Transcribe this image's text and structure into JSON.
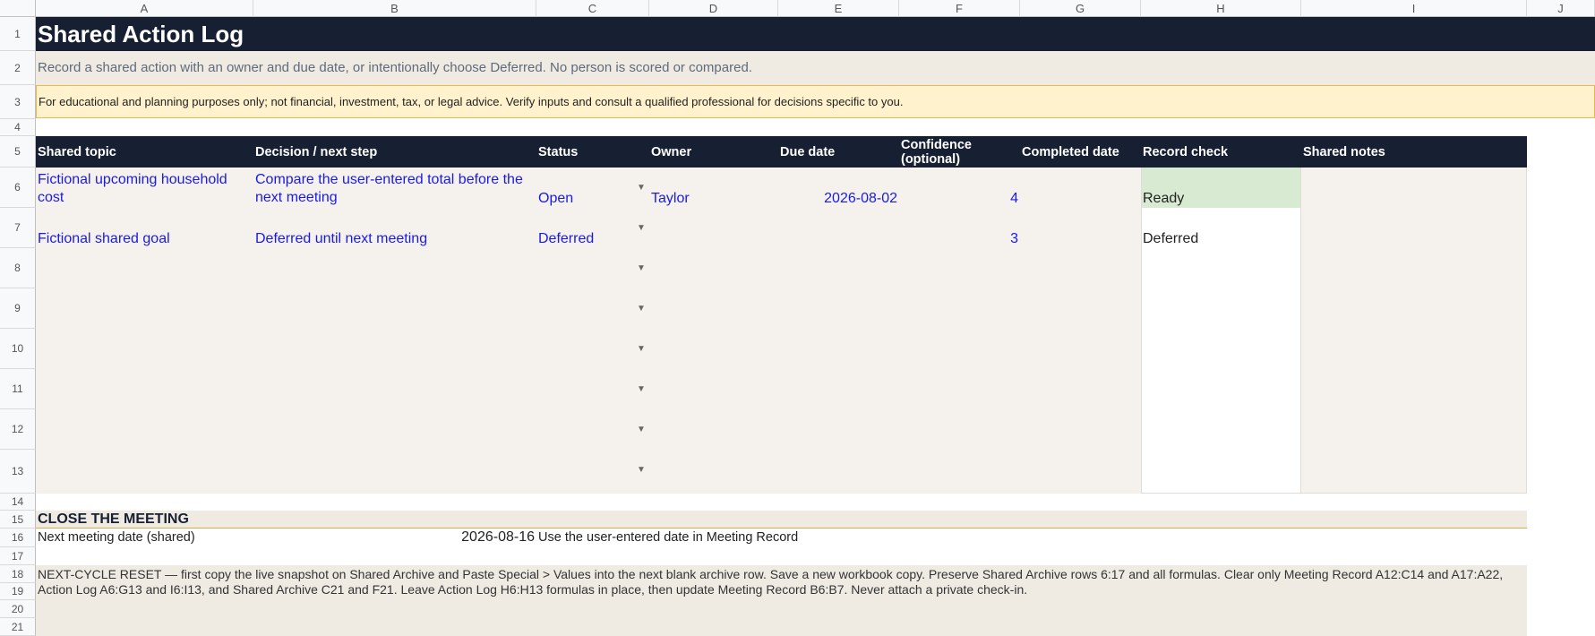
{
  "columns": [
    "A",
    "B",
    "C",
    "D",
    "E",
    "F",
    "G",
    "H",
    "I",
    "J"
  ],
  "rows": [
    "1",
    "2",
    "3",
    "4",
    "5",
    "6",
    "7",
    "8",
    "9",
    "10",
    "11",
    "12",
    "13",
    "14",
    "15",
    "16",
    "17",
    "18",
    "19",
    "20",
    "21"
  ],
  "title": "Shared Action Log",
  "subtitle": "Record a shared action with an owner and due date, or intentionally choose Deferred. No person is scored or compared.",
  "disclaimer": "For educational and planning purposes only; not financial, investment, tax, or legal advice. Verify inputs and consult a qualified professional for decisions specific to you.",
  "headers": {
    "topic": "Shared topic",
    "decision": "Decision / next step",
    "status": "Status",
    "owner": "Owner",
    "due": "Due date",
    "confidence": "Confidence (optional)",
    "completed": "Completed date",
    "check": "Record check",
    "notes": "Shared notes"
  },
  "entries": [
    {
      "topic": "Fictional upcoming household cost",
      "decision": "Compare the user-entered total before the next meeting",
      "status": "Open",
      "owner": "Taylor",
      "due": "2026-08-02",
      "confidence": "4",
      "check": "Ready"
    },
    {
      "topic": "Fictional shared goal",
      "decision": "Deferred until next meeting",
      "status": "Deferred",
      "owner": "",
      "due": "",
      "confidence": "3",
      "check": "Deferred"
    }
  ],
  "close_section": {
    "heading": "CLOSE THE MEETING",
    "label": "Next meeting date (shared)",
    "date": "2026-08-16",
    "note": "Use the user-entered date in Meeting Record"
  },
  "reset_text": "NEXT-CYCLE RESET — first copy the live snapshot on Shared Archive and Paste Special > Values into the next blank archive row. Save a new workbook copy. Preserve Shared Archive rows 6:17 and all formulas. Clear only Meeting Record A12:C14 and A17:A22, Action Log A6:G13 and I6:I13, and Shared Archive C21 and F21. Leave Action Log H6:H13 formulas in place, then update Meeting Record B6:B7. Never attach a private check-in.",
  "colors": {
    "header": "#172033",
    "body": "#f5f2ed",
    "input_text": "#1a1ae6",
    "ready": "#d9ead3",
    "disclaimer": "#fff2cc"
  }
}
